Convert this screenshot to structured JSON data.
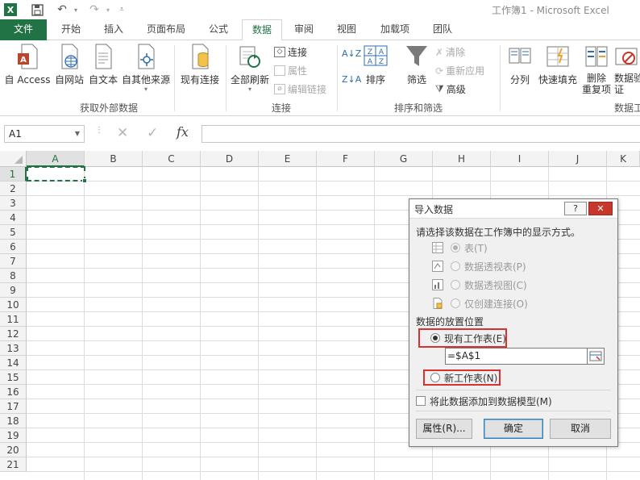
{
  "app": {
    "window_title": "工作簿1 - Microsoft Excel",
    "logo_letter": "X"
  },
  "quick_access": {
    "save_icon": "save-icon",
    "undo_icon": "undo-icon",
    "redo_icon": "redo-icon",
    "customize_icon": "customize-qat-icon"
  },
  "tabs": [
    "文件",
    "开始",
    "插入",
    "页面布局",
    "公式",
    "数据",
    "审阅",
    "视图",
    "加载项",
    "团队"
  ],
  "active_tab": "数据",
  "ribbon": {
    "external": {
      "label": "获取外部数据",
      "access": "自 Access",
      "web": "自网站",
      "text": "自文本",
      "other": "自其他来源",
      "existing": "现有连接"
    },
    "connections": {
      "label": "连接",
      "refresh_all": "全部刷新",
      "connections": "连接",
      "properties": "属性",
      "edit_links": "编辑链接"
    },
    "sort_filter": {
      "label": "排序和筛选",
      "sort": "排序",
      "filter": "筛选",
      "clear": "清除",
      "reapply": "重新应用",
      "advanced": "高级"
    },
    "data_tools": {
      "label": "数据工",
      "text_to_columns": "分列",
      "flash_fill": "快速填充",
      "remove_dup_1": "删除",
      "remove_dup_2": "重复项",
      "validation_1": "数据验",
      "validation_2": "证"
    }
  },
  "formula_bar": {
    "name_box": "A1",
    "cancel": "✕",
    "enter": "✓",
    "fx": "fx",
    "formula": ""
  },
  "sheet": {
    "columns": [
      "A",
      "B",
      "C",
      "D",
      "E",
      "F",
      "G",
      "H",
      "I",
      "J",
      "K"
    ],
    "rows": [
      "1",
      "2",
      "3",
      "4",
      "5",
      "6",
      "7",
      "8",
      "9",
      "10",
      "11",
      "12",
      "13",
      "14",
      "15",
      "16",
      "17",
      "18",
      "19",
      "20",
      "21"
    ],
    "selected_cell": "A1"
  },
  "dialog": {
    "title": "导入数据",
    "help": "?",
    "close": "✕",
    "prompt": "请选择该数据在工作簿中的显示方式。",
    "display_options": [
      {
        "label": "表(T)",
        "selected": true
      },
      {
        "label": "数据透视表(P)",
        "selected": false
      },
      {
        "label": "数据透视图(C)",
        "selected": false
      },
      {
        "label": "仅创建连接(O)",
        "selected": false
      }
    ],
    "location_title": "数据的放置位置",
    "existing_sheet": "现有工作表(E)",
    "existing_sheet_selected": true,
    "range_value": "=$A$1",
    "new_sheet": "新工作表(N)",
    "add_to_model": "将此数据添加到数据模型(M)",
    "add_to_model_checked": false,
    "btn_properties": "属性(R)...",
    "btn_ok": "确定",
    "btn_cancel": "取消"
  },
  "colors": {
    "excel_green": "#217346",
    "highlight_red": "#d93030",
    "dialog_bg": "#f0f0f0"
  }
}
